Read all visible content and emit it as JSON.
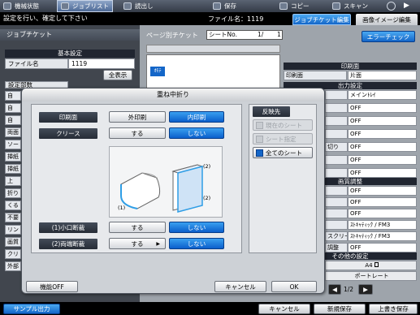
{
  "top_menu": {
    "items": [
      {
        "label": "機械状態",
        "icon": "machine-status-icon"
      },
      {
        "label": "ジョブリスト",
        "icon": "job-list-icon",
        "active": true
      },
      {
        "label": "読出し",
        "icon": "recall-icon"
      },
      {
        "label": "保存",
        "icon": "save-icon"
      },
      {
        "label": "コピー",
        "icon": "copy-icon"
      },
      {
        "label": "スキャン",
        "icon": "scan-icon"
      }
    ]
  },
  "status": {
    "message": "設定を行い、確定して下さい",
    "filename_label": "ファイル名：1119",
    "tab_job_ticket_edit": "ジョブチケット編集",
    "tab_image_edit": "画像イメージ編集"
  },
  "left_panel": {
    "title": "ジョブチケット",
    "basic_header": "基本設定",
    "filename_field_label": "ファイル名",
    "filename_value": "1119",
    "show_all_button": "全表示",
    "setting_partial_label": "設定部数",
    "side_items": [
      "自",
      "自",
      "自",
      "両面",
      "ソー",
      "挿紙",
      "挿紙",
      "上",
      "折り",
      "くる",
      "不要",
      "リン",
      "画質",
      "クリ",
      "外部"
    ]
  },
  "right_panel": {
    "page_ticket_label": "ページ別チケット",
    "sheet_no_label": "シートNo.",
    "sheet_no_value": "1/",
    "sheet_total": "1",
    "error_check_button": "エラーチェック",
    "print_side_header": "印刷面",
    "print_side_label": "印刷面",
    "print_side_value": "片面",
    "output_header": "出力設定",
    "output_values": [
      "メインﾄﾚｲ",
      "OFF",
      "OFF",
      "OFF",
      "OFF",
      "OFF",
      "OFF"
    ],
    "output_partial_labels": [
      "",
      "",
      "",
      "",
      "切り",
      "",
      ""
    ],
    "quality_header": "画質調整",
    "quality_values": [
      "OFF",
      "OFF",
      "OFF",
      "ｽﾄｷｬﾃｨｯｸ / FM3",
      "ｽﾄｷｬﾃｨｯｸ / FM3",
      "OFF"
    ],
    "quality_partial_labels": [
      "",
      "",
      "",
      "",
      "スクリーン",
      "調整"
    ],
    "other_header": "その他の設定",
    "paper_size": "A4",
    "orientation": "ポートレート",
    "page_indicator": "1/2",
    "thumb_label": "ｵﾓﾃ"
  },
  "dialog": {
    "title": "重ね中折り",
    "print_side_label": "印刷面",
    "print_side_options": [
      "外印刷",
      "内印刷"
    ],
    "print_side_selected": "内印刷",
    "crease_label": "クリース",
    "crease_options": [
      "する",
      "しない"
    ],
    "crease_selected": "しない",
    "fore_edge_label": "(1)小口断裁",
    "fore_edge_options": [
      "する",
      "しない"
    ],
    "fore_edge_selected": "しない",
    "both_edge_label": "(2)両端断裁",
    "both_edge_options": [
      "する",
      "しない"
    ],
    "both_edge_selected": "しない",
    "apply_header": "反映先",
    "apply_options": [
      "現在のシート",
      "シート指定",
      "全てのシート"
    ],
    "apply_selected": "全てのシート",
    "illus_label_1": "(1)",
    "illus_label_2a": "(2)",
    "illus_label_2b": "(2)",
    "function_off_button": "機能OFF",
    "cancel_button": "キャンセル",
    "ok_button": "OK"
  },
  "bottom": {
    "sample_output_button": "サンプル出力",
    "cancel_button": "キャンセル",
    "new_save_button": "新規保存",
    "overwrite_save_button": "上書き保存"
  }
}
